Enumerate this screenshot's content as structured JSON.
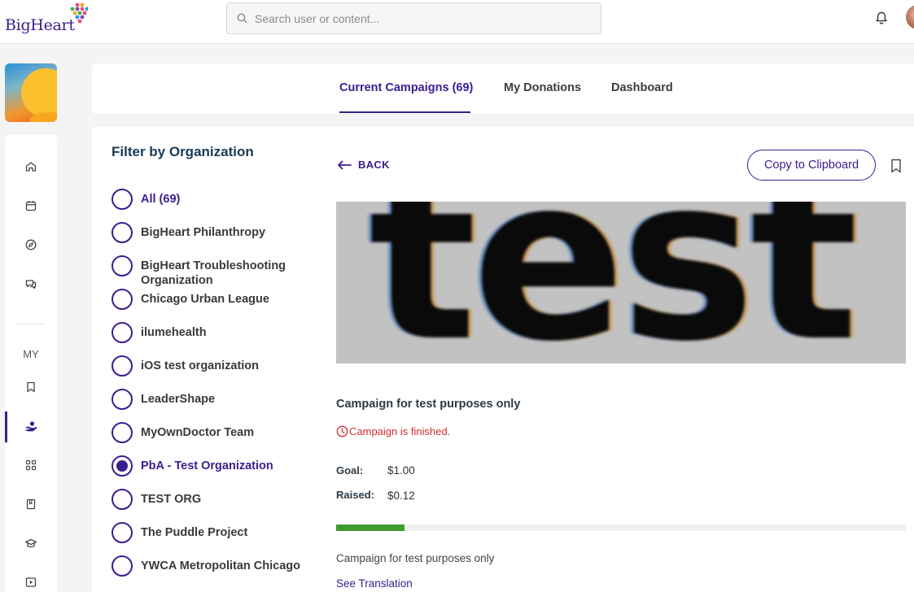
{
  "header": {
    "logo_text": "BigHeart",
    "search": {
      "placeholder": "Search user or content...",
      "value": ""
    }
  },
  "sidebar": {
    "my_label": "MY",
    "items": [
      {
        "icon": "home-icon"
      },
      {
        "icon": "calendar-icon"
      },
      {
        "icon": "compass-icon"
      },
      {
        "icon": "chat-icon"
      },
      {
        "icon": "bookmark-icon"
      },
      {
        "icon": "donate-hand-icon",
        "active": true
      },
      {
        "icon": "apps-grid-icon"
      },
      {
        "icon": "book-icon"
      },
      {
        "icon": "graduation-cap-icon"
      },
      {
        "icon": "video-icon"
      }
    ]
  },
  "tabs": [
    {
      "label": "Current Campaigns (69)",
      "active": true
    },
    {
      "label": "My Donations",
      "active": false
    },
    {
      "label": "Dashboard",
      "active": false
    }
  ],
  "filter": {
    "title": "Filter by Organization",
    "organizations": [
      {
        "label": "All (69)",
        "selected": false,
        "highlight": true
      },
      {
        "label": "BigHeart Philanthropy",
        "selected": false
      },
      {
        "label": "BigHeart Troubleshooting Organization",
        "selected": false
      },
      {
        "label": "Chicago Urban League",
        "selected": false
      },
      {
        "label": "ilumehealth",
        "selected": false
      },
      {
        "label": "iOS test organization",
        "selected": false
      },
      {
        "label": "LeaderShape",
        "selected": false
      },
      {
        "label": "MyOwnDoctor Team",
        "selected": false
      },
      {
        "label": "PbA - Test Organization",
        "selected": true
      },
      {
        "label": "TEST ORG",
        "selected": false
      },
      {
        "label": "The Puddle Project",
        "selected": false
      },
      {
        "label": "YWCA Metropolitan Chicago",
        "selected": false
      }
    ]
  },
  "campaign": {
    "back_label": "BACK",
    "copy_label": "Copy to Clipboard",
    "banner_text": "test",
    "title": "Campaign for test purposes only",
    "status": "Campaign is finished.",
    "goal_label": "Goal:",
    "goal_value": "$1.00",
    "raised_label": "Raised:",
    "raised_value": "$0.12",
    "progress_fraction": 0.12,
    "description": "Campaign for test purposes only",
    "translation_link": "See Translation"
  },
  "colors": {
    "accent": "#3b1d8f",
    "progress": "#3f9a2f",
    "error": "#d32f2f"
  }
}
